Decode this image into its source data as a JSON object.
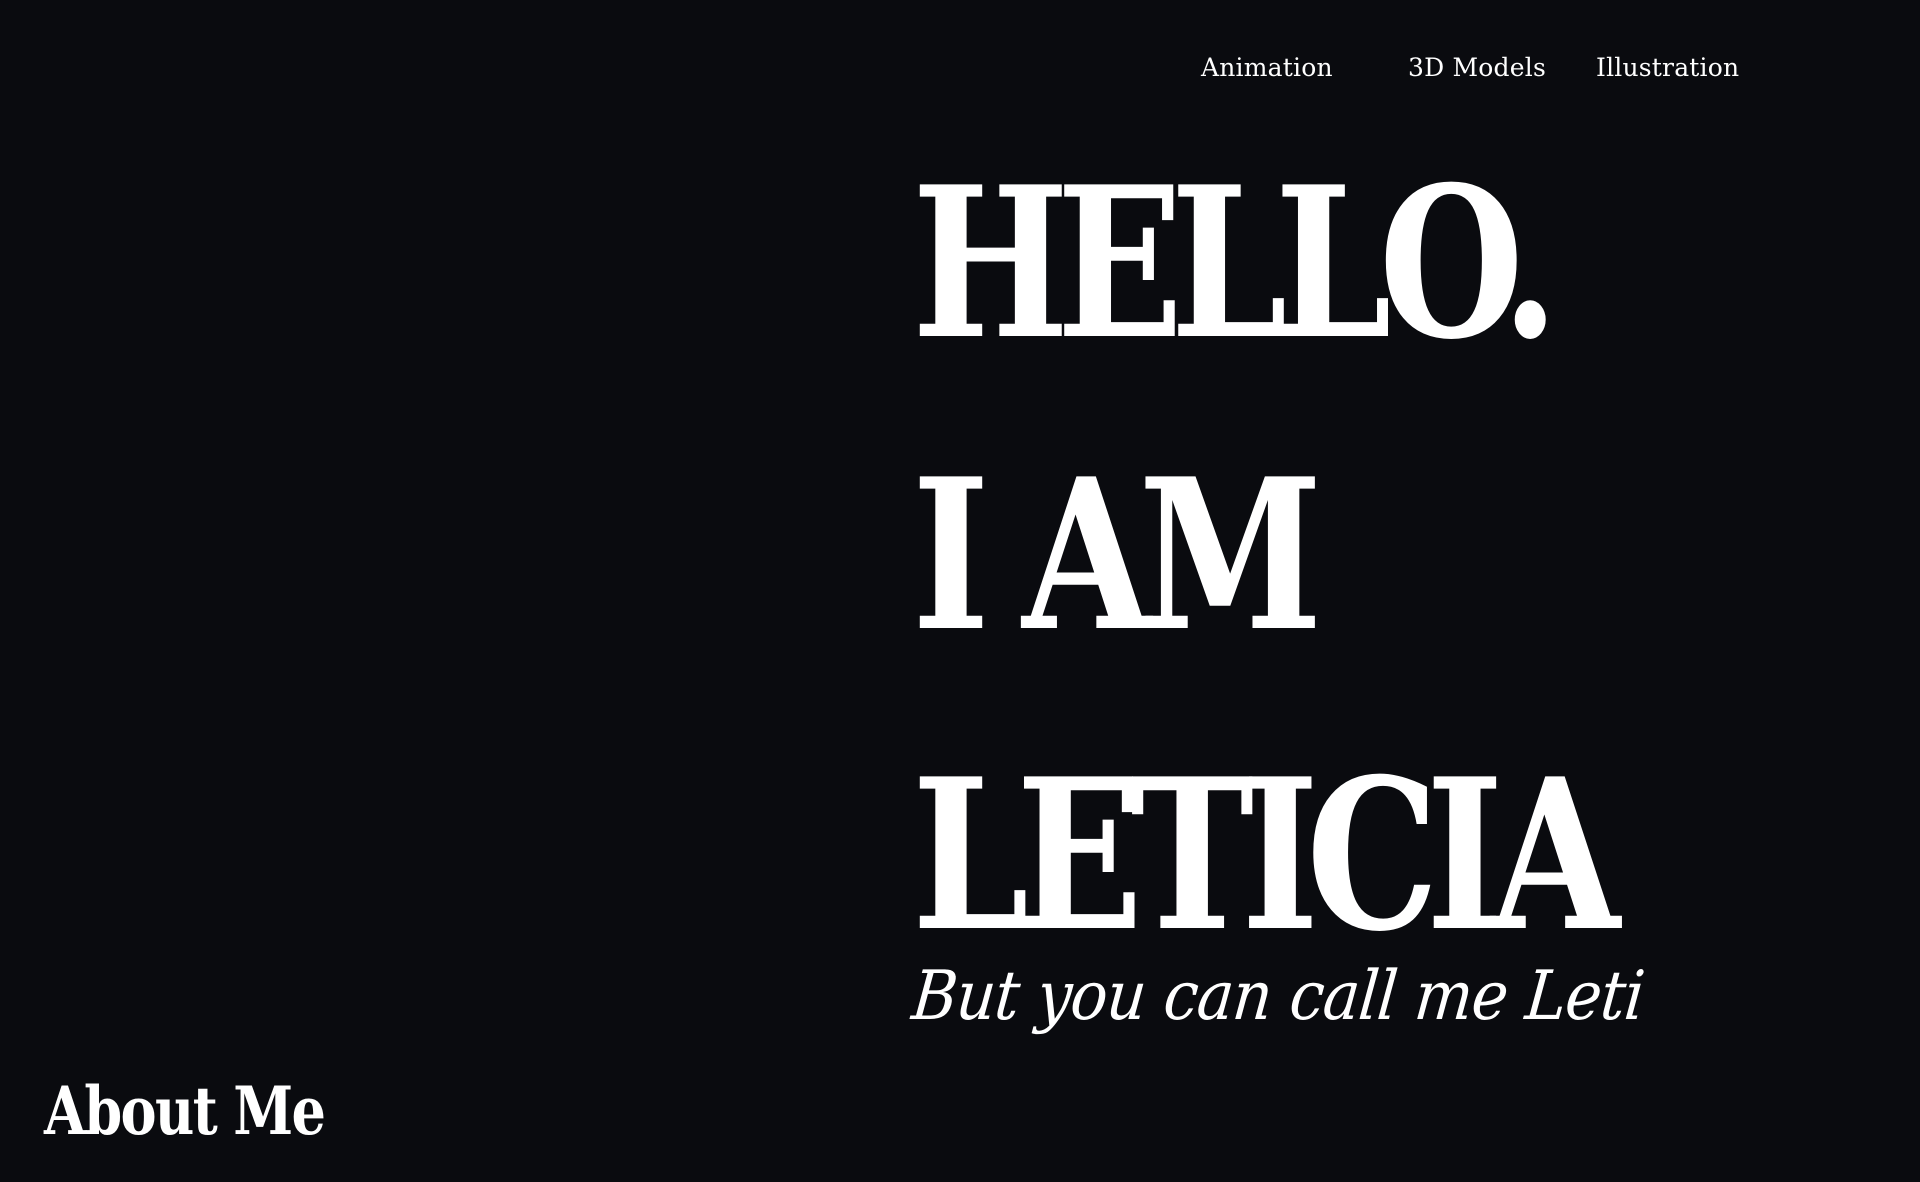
{
  "nav": {
    "items": [
      {
        "label": "Animation"
      },
      {
        "label": "3D Models"
      },
      {
        "label": "Illustration"
      }
    ]
  },
  "hero": {
    "line1": "HELLO.",
    "line2": "I AM",
    "line3": "LETICIA",
    "tagline": "But you can call me Leti"
  },
  "footer": {
    "about_label": "About Me"
  },
  "colors": {
    "background": "#0a0b0f",
    "text": "#ffffff"
  }
}
